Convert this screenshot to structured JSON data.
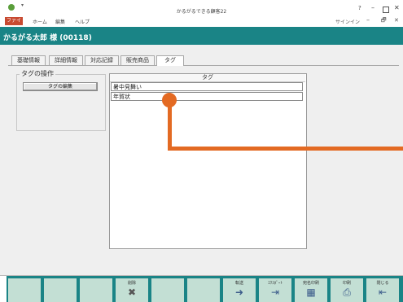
{
  "window": {
    "title": "かるがるできる顧客22",
    "help": "?",
    "minimize": "–",
    "close": "✕"
  },
  "ribbon": {
    "tabs": [
      "ファイル",
      "ホーム",
      "編集",
      "ヘルプ"
    ],
    "signin": "サインイン",
    "minimize": "–",
    "restore": "🗗",
    "close": "✕"
  },
  "customer": {
    "name": "かるがる太郎 様 (00118)"
  },
  "tabs": [
    "基礎情報",
    "詳細情報",
    "対応記録",
    "販売商品",
    "タグ"
  ],
  "operations": {
    "legend": "タグの操作",
    "edit_button": "タグの編集"
  },
  "tag_list": {
    "header": "タグ",
    "rows": [
      "暑中見舞い",
      "年賀状"
    ]
  },
  "colors": {
    "accent_teal": "#1a8486",
    "callout_orange": "#e36a23",
    "file_tab_red": "#c84a31",
    "fkey_bg": "#c3dfd4"
  },
  "function_keys": [
    {
      "label": "",
      "icon": ""
    },
    {
      "label": "",
      "icon": ""
    },
    {
      "label": "",
      "icon": ""
    },
    {
      "label": "削除",
      "icon": "delete-icon",
      "glyph": "✖"
    },
    {
      "label": "",
      "icon": ""
    },
    {
      "label": "",
      "icon": ""
    },
    {
      "label": "転送",
      "icon": "transfer-icon",
      "glyph": "➜"
    },
    {
      "label": "ｴｸｽﾎﾟｰﾄ",
      "icon": "export-icon",
      "glyph": "⇥"
    },
    {
      "label": "宛名印刷",
      "icon": "address-print-icon",
      "glyph": "▦"
    },
    {
      "label": "印刷",
      "icon": "print-icon",
      "glyph": "⎙"
    },
    {
      "label": "閉じる",
      "icon": "close-door-icon",
      "glyph": "⇤"
    }
  ]
}
